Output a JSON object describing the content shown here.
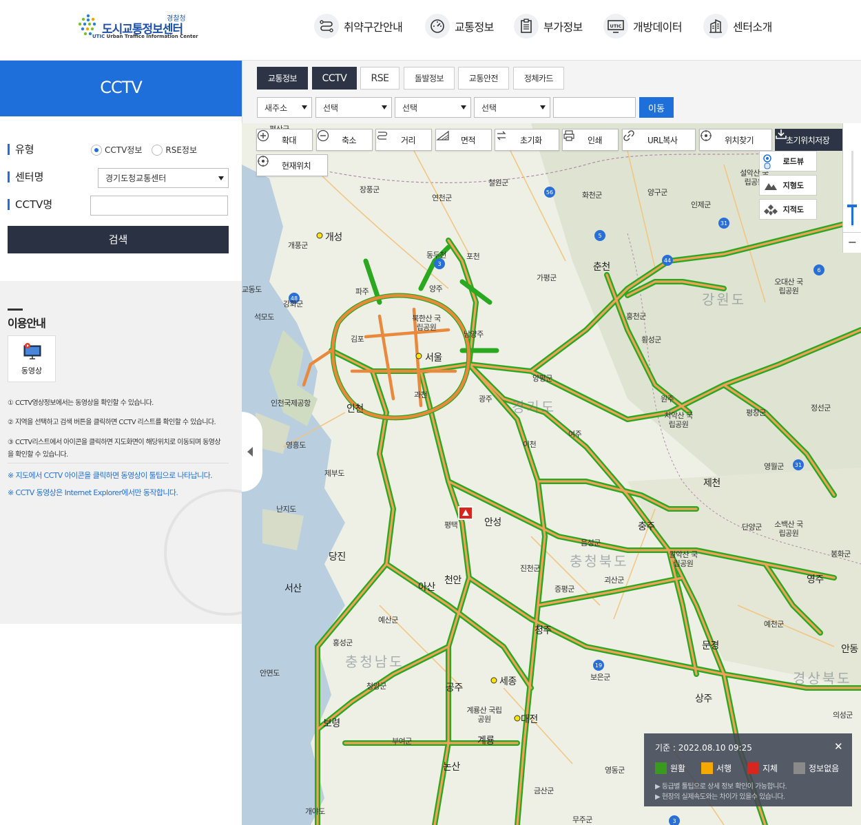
{
  "header": {
    "logo_small": "경찰청",
    "logo_main": "도시교통정보센터",
    "logo_mark": "UTIC",
    "logo_sub": "Urban Traffice Information Center",
    "nav": [
      {
        "label": "취약구간안내",
        "icon": "route-icon"
      },
      {
        "label": "교통정보",
        "icon": "speedometer-icon"
      },
      {
        "label": "부가정보",
        "icon": "clipboard-icon"
      },
      {
        "label": "개방데이터",
        "icon": "monitor-icon"
      },
      {
        "label": "센터소개",
        "icon": "building-icon"
      }
    ]
  },
  "left": {
    "title": "CCTV",
    "type_label": "유형",
    "radio_cctv": "CCTV정보",
    "radio_rse": "RSE정보",
    "center_label": "센터명",
    "center_value": "경기도청교통센터",
    "cctv_name_label": "CCTV명",
    "cctv_name_value": "",
    "search_button": "검색",
    "guide_title": "이용안내",
    "video_label": "동영상",
    "guide_lines": [
      "① CCTV영상정보에서는 동영상을 확인할 수 있습니다.",
      "② 지역을 선택하고 검색 버튼을 클릭하면 CCTV 리스트를 확인할 수 있습니다.",
      "③ CCTV리스트에서 아이콘을 클릭하면 지도화면이 해당위치로 이동되며 동영상을 확인할 수 있습니다."
    ],
    "notes": [
      "※ 지도에서 CCTV 아이콘을 클릭하면 동영상이 툴팁으로 나타납니다.",
      "※ CCTV 동영상은 Internet Explorer에서만 동작합니다."
    ]
  },
  "tabs": [
    "교통정보",
    "CCTV",
    "RSE",
    "돌발정보",
    "교통안전",
    "정체카드"
  ],
  "search_row": {
    "address_type": "새주소",
    "select1": "선택",
    "select2": "선택",
    "select3": "선택",
    "keyword": "",
    "go_button": "이동"
  },
  "map_tools": [
    "확대",
    "축소",
    "거리",
    "면적",
    "초기화",
    "인쇄",
    "URL복사",
    "위치찾기",
    "현재위치"
  ],
  "save_init": "초기위치저장",
  "map_types": [
    "로드뷰",
    "지형도",
    "지적도"
  ],
  "legend": {
    "time": "기준 : 2022.08.10 09:25",
    "items": [
      {
        "label": "원활",
        "color": "#3a9a1e"
      },
      {
        "label": "서행",
        "color": "#f5a800"
      },
      {
        "label": "지체",
        "color": "#d8261e"
      },
      {
        "label": "정보없음",
        "color": "#8a8a8a"
      }
    ],
    "note1": "▶ 등급별 툴팁으로 상세 정보 확인이 가능합니다.",
    "note2": "▶ 현장의 실제속도와는 차이가 있을수 있습니다."
  },
  "map_labels": [
    {
      "t": "평산군"
    },
    {
      "t": "철원군"
    },
    {
      "t": "화천군"
    },
    {
      "t": "양구군"
    },
    {
      "t": "인제군"
    },
    {
      "t": "연천군"
    },
    {
      "t": "장풍군"
    },
    {
      "t": "개성"
    },
    {
      "t": "개풍군"
    },
    {
      "t": "동두천"
    },
    {
      "t": "포천"
    },
    {
      "t": "춘천"
    },
    {
      "t": "가평군"
    },
    {
      "t": "양주"
    },
    {
      "t": "파주"
    },
    {
      "t": "강화군"
    },
    {
      "t": "교동도"
    },
    {
      "t": "석모도"
    },
    {
      "t": "김포"
    },
    {
      "t": "남양주"
    },
    {
      "t": "서울"
    },
    {
      "t": "홍천군"
    },
    {
      "t": "양평군"
    },
    {
      "t": "인천국제공항"
    },
    {
      "t": "인천"
    },
    {
      "t": "과천"
    },
    {
      "t": "광주"
    },
    {
      "t": "여주"
    },
    {
      "t": "이천"
    },
    {
      "t": "원주"
    },
    {
      "t": "영흥도"
    },
    {
      "t": "제부도"
    },
    {
      "t": "횡성군"
    },
    {
      "t": "평창군"
    },
    {
      "t": "정선군"
    },
    {
      "t": "영월군"
    },
    {
      "t": "제천"
    },
    {
      "t": "난지도"
    },
    {
      "t": "평택"
    },
    {
      "t": "안성"
    },
    {
      "t": "충주"
    },
    {
      "t": "단양군"
    },
    {
      "t": "음성군"
    },
    {
      "t": "당진"
    },
    {
      "t": "천안"
    },
    {
      "t": "진천군"
    },
    {
      "t": "괴산군"
    },
    {
      "t": "서산"
    },
    {
      "t": "아산"
    },
    {
      "t": "증평군"
    },
    {
      "t": "영주"
    },
    {
      "t": "봉화군"
    },
    {
      "t": "예산군"
    },
    {
      "t": "청주"
    },
    {
      "t": "문경"
    },
    {
      "t": "예천군"
    },
    {
      "t": "안동"
    },
    {
      "t": "홍성군"
    },
    {
      "t": "안면도"
    },
    {
      "t": "청양군"
    },
    {
      "t": "세종"
    },
    {
      "t": "공주"
    },
    {
      "t": "보은군"
    },
    {
      "t": "상주"
    },
    {
      "t": "의성군"
    },
    {
      "t": "보령"
    },
    {
      "t": "부여군"
    },
    {
      "t": "계룡산 국립공원"
    },
    {
      "t": "대전"
    },
    {
      "t": "계룡"
    },
    {
      "t": "논산"
    },
    {
      "t": "영동군"
    },
    {
      "t": "금산군"
    },
    {
      "t": "개야도"
    },
    {
      "t": "무주군"
    },
    {
      "t": "설악산 국립공원"
    },
    {
      "t": "오대산 국립공원"
    },
    {
      "t": "치악산 국립공원"
    },
    {
      "t": "월악산 국립공원"
    },
    {
      "t": "소백산 국립공원"
    },
    {
      "t": "북한산 국립공원"
    },
    {
      "t": "강원도"
    },
    {
      "t": "경기도"
    },
    {
      "t": "충청북도"
    },
    {
      "t": "충청남도"
    },
    {
      "t": "경상북도"
    }
  ]
}
